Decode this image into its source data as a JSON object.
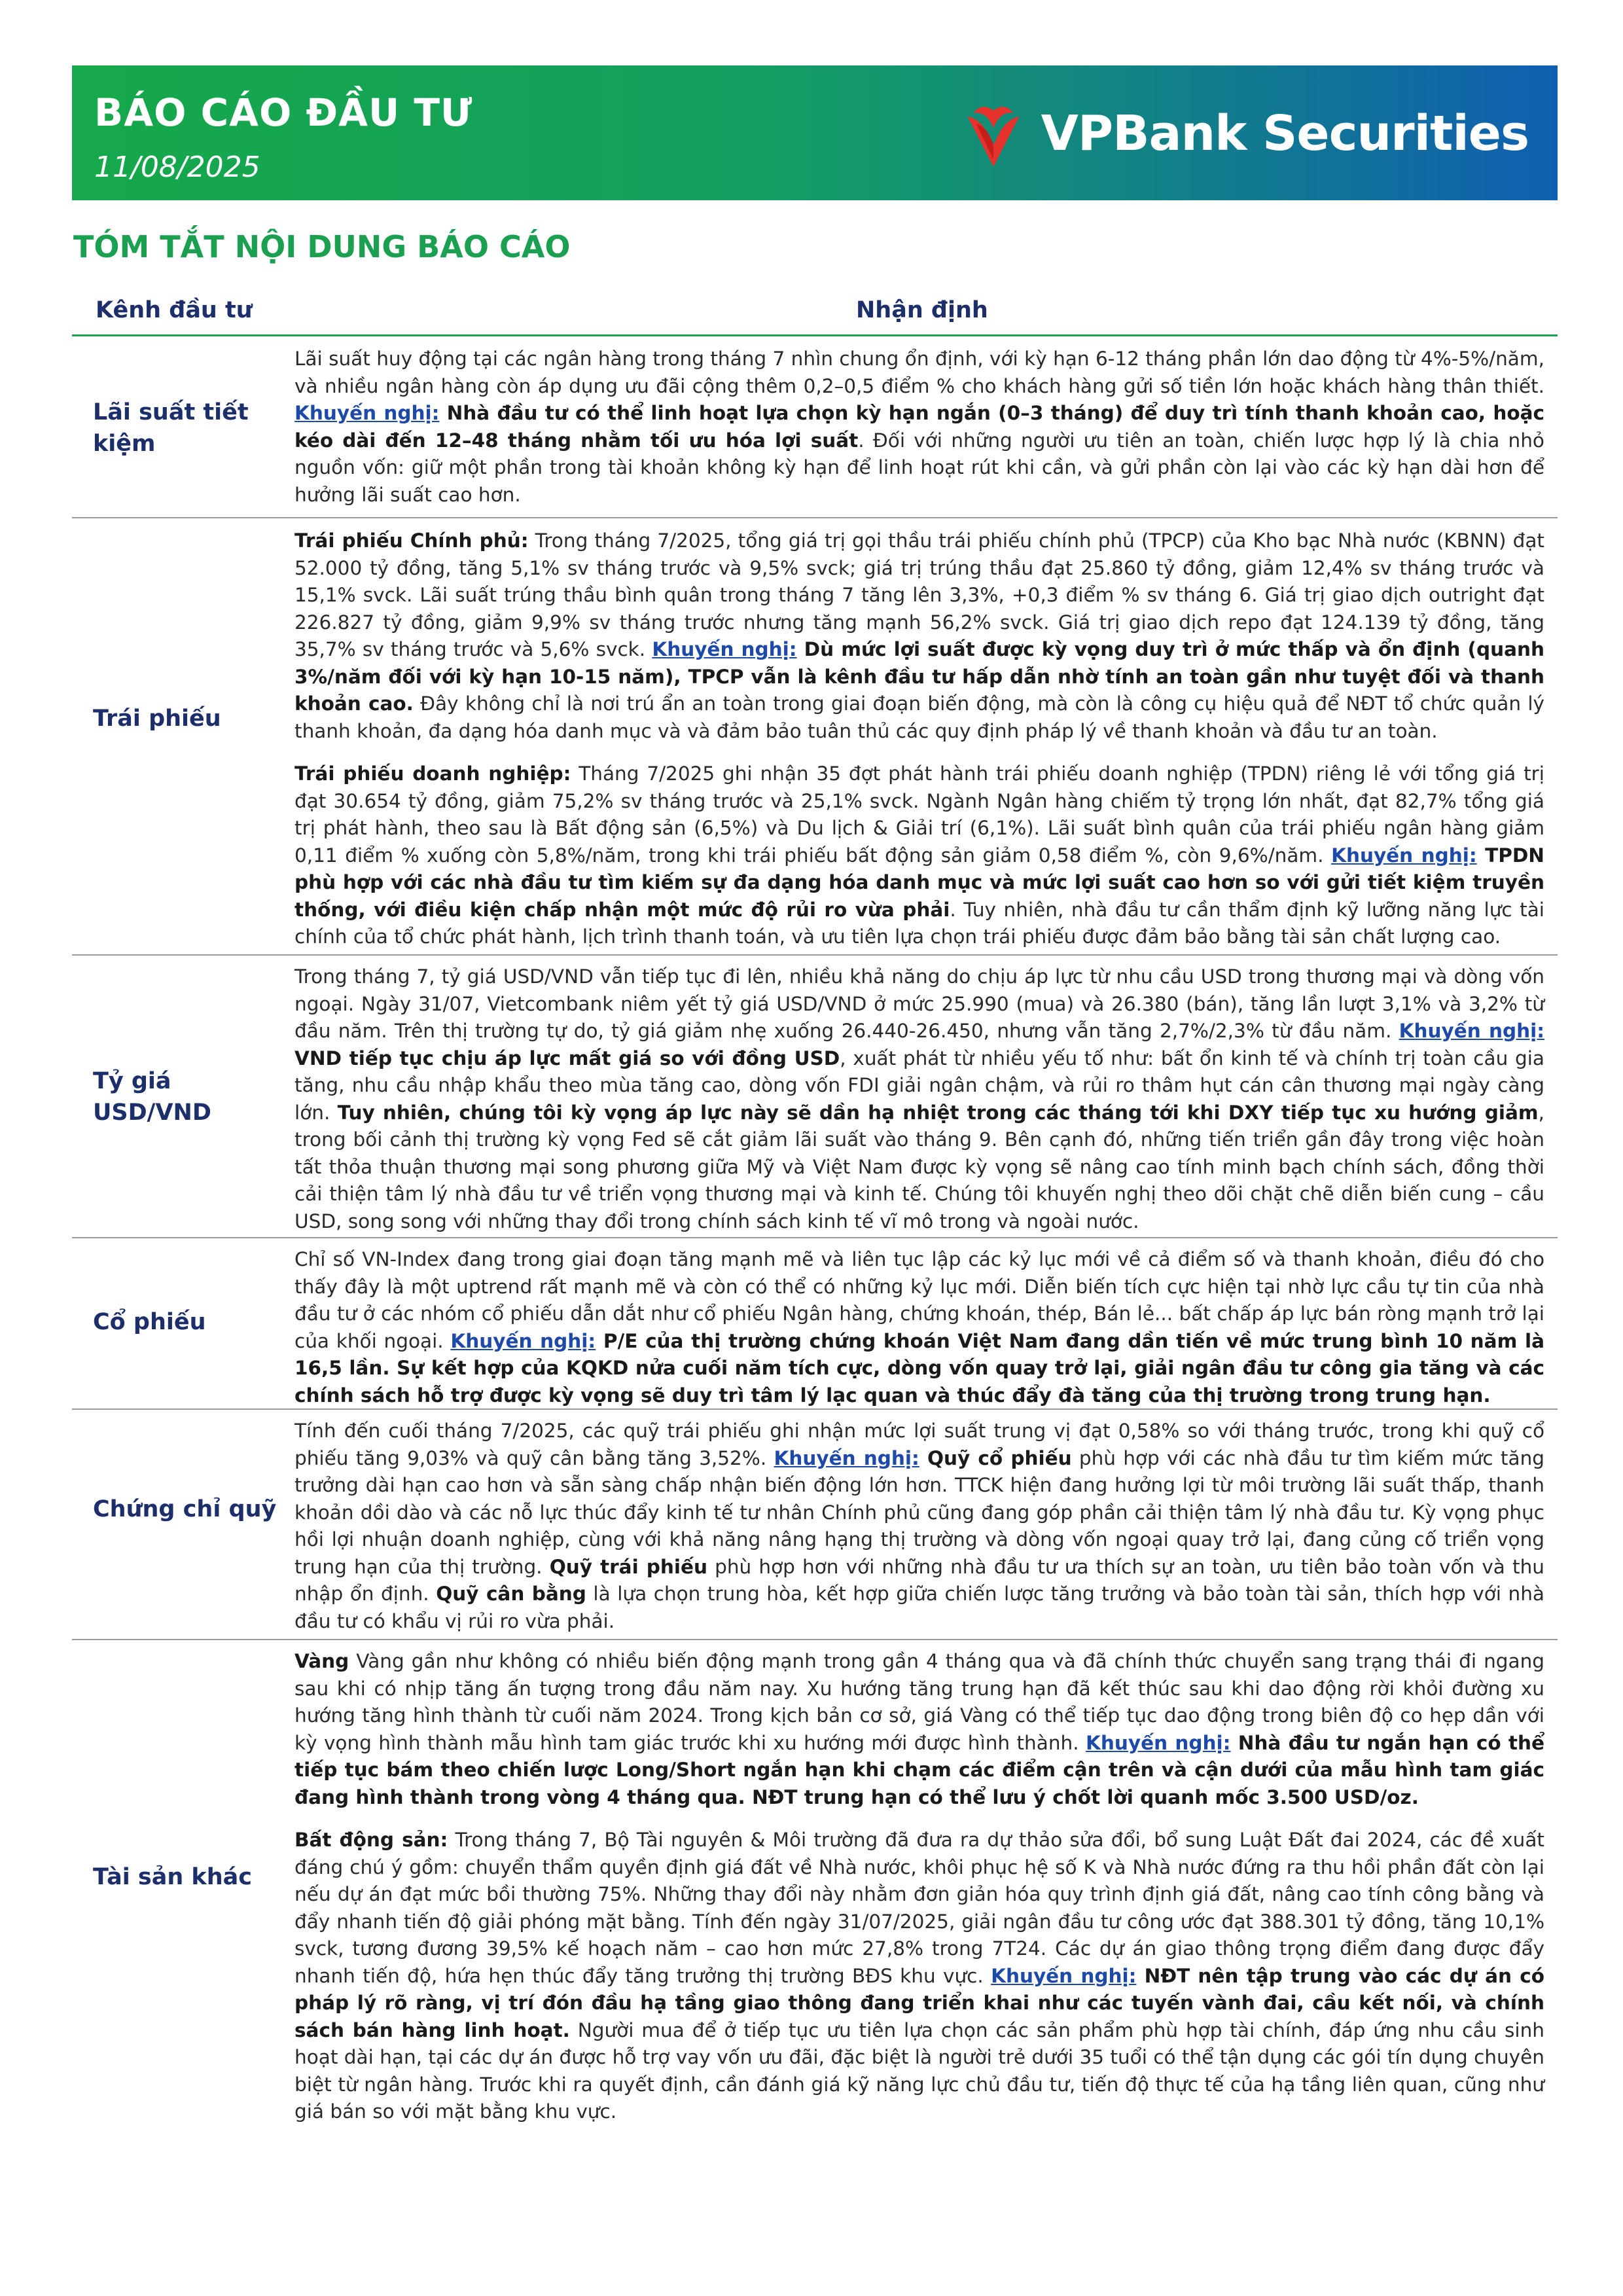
{
  "header": {
    "title": "BÁO CÁO ĐẦU TƯ",
    "date": "11/08/2025",
    "logo_text": "VPBank Securities",
    "logo_color": "#e5322d"
  },
  "section_title": "TÓM TẮT NỘI DUNG BÁO CÁO",
  "table": {
    "col1": "Kênh đầu tư",
    "col2": "Nhận định"
  },
  "rows": [
    {
      "label": "Lãi suất tiết kiệm",
      "paras": [
        [
          {
            "t": "Lãi suất huy động tại các ngân hàng trong tháng 7 nhìn chung ổn định, với kỳ hạn 6-12 tháng phần lớn dao động từ 4%-5%/năm, và nhiều ngân hàng còn áp dụng ưu đãi cộng thêm 0,2–0,5 điểm % cho khách hàng gửi số tiền lớn hoặc khách hàng thân thiết. "
          },
          {
            "t": "Khuyến nghị:",
            "s": "k"
          },
          {
            "t": " Nhà đầu tư có thể linh hoạt lựa chọn kỳ hạn ngắn (0–3 tháng) để duy trì tính thanh khoản cao, hoặc kéo dài đến 12–48 tháng nhằm tối ưu hóa lợi suất",
            "s": "b"
          },
          {
            "t": ". Đối với những người ưu tiên an toàn, chiến lược hợp lý là chia nhỏ nguồn vốn: giữ một phần trong tài khoản không kỳ hạn để linh hoạt rút khi cần, và gửi phần còn lại vào các kỳ hạn dài hơn để hưởng lãi suất cao hơn."
          }
        ]
      ]
    },
    {
      "label": "Trái phiếu",
      "paras": [
        [
          {
            "t": "Trái phiếu Chính phủ:",
            "s": "b"
          },
          {
            "t": " Trong tháng 7/2025, tổng giá trị gọi thầu trái phiếu chính phủ (TPCP) của Kho bạc Nhà nước (KBNN) đạt 52.000 tỷ đồng, tăng 5,1% sv tháng trước và 9,5% svck; giá trị trúng thầu đạt 25.860 tỷ đồng, giảm 12,4% sv tháng trước và 15,1% svck. Lãi suất trúng thầu bình quân trong tháng 7 tăng lên 3,3%, +0,3 điểm % sv tháng 6. Giá trị giao dịch outright đạt 226.827 tỷ đồng, giảm 9,9% sv tháng trước nhưng tăng mạnh 56,2% svck. Giá trị giao dịch repo đạt 124.139 tỷ đồng, tăng 35,7% sv tháng trước và 5,6% svck. "
          },
          {
            "t": "Khuyến nghị:",
            "s": "k"
          },
          {
            "t": " Dù mức lợi suất được kỳ vọng duy trì ở mức thấp và ổn định (quanh 3%/năm đối với kỳ hạn 10-15 năm), TPCP vẫn là kênh đầu tư hấp dẫn nhờ tính an toàn gần như tuyệt đối và thanh khoản cao.",
            "s": "b"
          },
          {
            "t": " Đây không chỉ là nơi trú ẩn an toàn trong giai đoạn biến động, mà còn là công cụ hiệu quả để NĐT tổ chức quản lý thanh khoản, đa dạng hóa danh mục và và đảm bảo tuân thủ các quy định pháp lý về thanh khoản và đầu tư an toàn."
          }
        ],
        [
          {
            "t": "Trái phiếu doanh nghiệp:",
            "s": "b"
          },
          {
            "t": " Tháng 7/2025 ghi nhận 35 đợt phát hành trái phiếu doanh nghiệp (TPDN) riêng lẻ với tổng giá trị đạt 30.654 tỷ đồng, giảm 75,2% sv tháng trước và 25,1% svck. Ngành Ngân hàng chiếm tỷ trọng lớn nhất, đạt 82,7% tổng giá trị phát hành, theo sau là Bất động sản (6,5%) và Du lịch & Giải trí (6,1%). Lãi suất bình quân của trái phiếu ngân hàng giảm 0,11 điểm % xuống còn 5,8%/năm, trong khi trái phiếu bất động sản giảm 0,58 điểm %, còn 9,6%/năm. "
          },
          {
            "t": "Khuyến nghị:",
            "s": "k"
          },
          {
            "t": " TPDN phù hợp với các nhà đầu tư tìm kiếm sự đa dạng hóa danh mục và mức lợi suất cao hơn so với gửi tiết kiệm truyền thống, với điều kiện chấp nhận một mức độ rủi ro vừa phải",
            "s": "b"
          },
          {
            "t": ". Tuy nhiên, nhà đầu tư cần thẩm định kỹ lưỡng năng lực tài chính của tổ chức phát hành, lịch trình thanh toán, và ưu tiên lựa chọn trái phiếu được đảm bảo bằng tài sản chất lượng cao."
          }
        ]
      ]
    },
    {
      "label": "Tỷ giá USD/VND",
      "paras": [
        [
          {
            "t": "Trong tháng 7, tỷ giá USD/VND vẫn tiếp tục đi lên, nhiều khả năng do chịu áp lực từ nhu cầu USD trong thương mại và dòng vốn ngoại. Ngày 31/07, Vietcombank niêm yết tỷ giá USD/VND ở mức 25.990 (mua) và 26.380 (bán), tăng lần lượt 3,1% và 3,2% từ đầu năm. Trên thị trường tự do, tỷ giá giảm nhẹ xuống 26.440-26.450, nhưng vẫn tăng 2,7%/2,3% từ đầu năm. "
          },
          {
            "t": "Khuyến nghị:",
            "s": "k"
          },
          {
            "t": " VND tiếp tục chịu áp lực mất giá so với đồng USD",
            "s": "b"
          },
          {
            "t": ", xuất phát từ nhiều yếu tố như: bất ổn kinh tế và chính trị toàn cầu gia tăng, nhu cầu nhập khẩu theo mùa tăng cao, dòng vốn FDI giải ngân chậm, và rủi ro thâm hụt cán cân thương mại ngày càng lớn. "
          },
          {
            "t": "Tuy nhiên, chúng tôi kỳ vọng áp lực này sẽ dần hạ nhiệt trong các tháng tới khi DXY tiếp tục xu hướng giảm",
            "s": "b"
          },
          {
            "t": ", trong bối cảnh thị trường kỳ vọng Fed sẽ cắt giảm lãi suất vào tháng 9. Bên cạnh đó, những tiến triển gần đây trong việc hoàn tất thỏa thuận thương mại song phương giữa Mỹ và Việt Nam được kỳ vọng sẽ nâng cao tính minh bạch chính sách, đồng thời cải thiện tâm lý nhà đầu tư về triển vọng thương mại và kinh tế. Chúng tôi khuyến nghị theo dõi chặt chẽ diễn biến cung – cầu USD, song song với những thay đổi trong chính sách kinh tế vĩ mô trong và ngoài nước."
          }
        ]
      ]
    },
    {
      "label": "Cổ phiếu",
      "paras": [
        [
          {
            "t": "Chỉ số VN-Index đang trong giai đoạn tăng mạnh mẽ và liên tục lập các kỷ lục mới về cả điểm số và thanh khoản, điều đó cho thấy đây là một uptrend rất mạnh mẽ và còn có thể có những kỷ lục mới. Diễn biến tích cực hiện tại nhờ lực cầu tự tin của nhà đầu tư ở các nhóm cổ phiếu dẫn dắt như cổ phiếu Ngân hàng, chứng khoán, thép, Bán lẻ... bất chấp áp lực bán ròng mạnh trở lại của khối ngoại. "
          },
          {
            "t": "Khuyến nghị:",
            "s": "k"
          },
          {
            "t": " P/E của thị trường chứng khoán Việt Nam đang dần tiến về mức trung bình 10 năm là 16,5 lần. Sự kết hợp của KQKD nửa cuối năm tích cực, dòng vốn quay trở lại, giải ngân đầu tư công gia tăng và các chính sách hỗ trợ được kỳ vọng sẽ duy trì tâm lý lạc quan và thúc đẩy đà tăng của thị trường trong trung hạn.",
            "s": "b"
          }
        ]
      ]
    },
    {
      "label": "Chứng chỉ quỹ",
      "paras": [
        [
          {
            "t": "Tính đến cuối tháng 7/2025, các quỹ trái phiếu ghi nhận mức lợi suất trung vị đạt 0,58% so với tháng trước, trong khi quỹ cổ phiếu tăng 9,03% và quỹ cân bằng tăng 3,52%. "
          },
          {
            "t": "Khuyến nghị:",
            "s": "k"
          },
          {
            "t": " Quỹ cổ phiếu",
            "s": "b"
          },
          {
            "t": " phù hợp với các nhà đầu tư tìm kiếm mức tăng trưởng dài hạn cao hơn và sẵn sàng chấp nhận biến động lớn hơn. TTCK hiện đang hưởng lợi từ môi trường lãi suất thấp, thanh khoản dồi dào và các nỗ lực thúc đẩy kinh tế tư nhân Chính phủ cũng đang góp phần cải thiện tâm lý nhà đầu tư. Kỳ vọng phục hồi lợi nhuận doanh nghiệp, cùng với khả năng nâng hạng thị trường và dòng vốn ngoại quay trở lại, đang củng cố triển vọng trung hạn của thị trường. "
          },
          {
            "t": "Quỹ trái phiếu",
            "s": "b"
          },
          {
            "t": " phù hợp hơn với những nhà đầu tư ưa thích sự an toàn, ưu tiên bảo toàn vốn và thu nhập ổn định. "
          },
          {
            "t": "Quỹ cân bằng",
            "s": "b"
          },
          {
            "t": " là lựa chọn trung hòa, kết hợp giữa chiến lược tăng trưởng và bảo toàn tài sản, thích hợp với nhà đầu tư có khẩu vị rủi ro vừa phải."
          }
        ]
      ]
    },
    {
      "label": "Tài sản khác",
      "paras": [
        [
          {
            "t": "Vàng",
            "s": "b"
          },
          {
            "t": " Vàng gần như không có nhiều biến động mạnh trong gần 4 tháng qua và đã chính thức chuyển sang trạng thái đi ngang sau khi có nhịp tăng ấn tượng trong đầu năm nay. Xu hướng tăng trung hạn đã kết thúc sau khi dao động rời khỏi đường xu hướng tăng hình thành từ cuối năm 2024. Trong kịch bản cơ sở, giá Vàng có thể tiếp tục dao động trong biên độ co hẹp dần với kỳ vọng hình thành mẫu hình tam giác trước khi xu hướng mới được hình thành. "
          },
          {
            "t": "Khuyến nghị:",
            "s": "k"
          },
          {
            "t": " Nhà đầu tư ngắn hạn có thể tiếp tục bám theo chiến lược Long/Short ngắn hạn khi chạm các điểm cận trên và cận dưới của mẫu hình tam giác đang hình thành trong vòng 4 tháng qua. NĐT trung hạn có thể lưu ý chốt lời quanh mốc 3.500 USD/oz.",
            "s": "b"
          }
        ],
        [
          {
            "t": "Bất động sản:",
            "s": "b"
          },
          {
            "t": " Trong tháng 7, Bộ Tài nguyên & Môi trường đã đưa ra dự thảo sửa đổi, bổ sung Luật Đất đai 2024, các đề xuất đáng chú ý gồm: chuyển thẩm quyền định giá đất về Nhà nước, khôi phục hệ số K và Nhà nước đứng ra thu hồi phần đất còn lại nếu dự án đạt mức bồi thường 75%. Những thay đổi này nhằm đơn giản hóa quy trình định giá đất, nâng cao tính công bằng và đẩy nhanh tiến độ giải phóng mặt bằng. Tính đến ngày 31/07/2025, giải ngân đầu tư công ước đạt 388.301 tỷ đồng, tăng 10,1% svck, tương đương 39,5% kế hoạch năm – cao hơn mức 27,8% trong 7T24. Các dự án giao thông trọng điểm đang được đẩy nhanh tiến độ, hứa hẹn thúc đẩy tăng trưởng thị trường BĐS khu vực. "
          },
          {
            "t": "Khuyến nghị:",
            "s": "k"
          },
          {
            "t": " NĐT nên tập trung vào các dự án có pháp lý rõ ràng, vị trí đón đầu hạ tầng giao thông đang triển khai như các tuyến vành đai, cầu kết nối, và chính sách bán hàng linh hoạt.",
            "s": "b"
          },
          {
            "t": " Người mua để ở tiếp tục ưu tiên lựa chọn các sản phẩm phù hợp tài chính, đáp ứng nhu cầu sinh hoạt dài hạn, tại các dự án được hỗ trợ vay vốn ưu đãi, đặc biệt là người trẻ dưới 35 tuổi có thể tận dụng các gói tín dụng chuyên biệt từ ngân hàng. Trước khi ra quyết định, cần đánh giá kỹ năng lực chủ đầu tư, tiến độ thực tế của hạ tầng liên quan, cũng như giá bán so với mặt bằng khu vực."
          }
        ]
      ]
    }
  ]
}
